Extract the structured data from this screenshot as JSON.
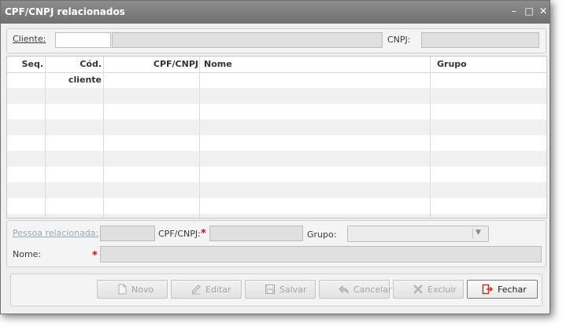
{
  "window": {
    "title": "CPF/CNPJ relacionados",
    "controls": {
      "minimize": "–",
      "maximize": "□",
      "close": "✕"
    }
  },
  "filter": {
    "cliente_label": "Cliente:",
    "cliente_code": "",
    "cliente_name": "",
    "cnpj_label": "CNPJ:",
    "cnpj_value": ""
  },
  "grid": {
    "columns": [
      "Seq.",
      "Cód. cliente",
      "CPF/CNPJ",
      "Nome",
      "Grupo"
    ],
    "rows": []
  },
  "form": {
    "pessoa_label": "Pessoa relacionada:",
    "cpf_label": "CPF/CNPJ:",
    "grupo_label": "Grupo:",
    "nome_label": "Nome:",
    "required_mark": "*"
  },
  "toolbar": {
    "novo": "Novo",
    "editar": "Editar",
    "salvar": "Salvar",
    "cancelar": "Cancelar",
    "excluir": "Excluir",
    "fechar": "Fechar"
  },
  "icons": {
    "novo": "document-icon",
    "editar": "pencil-icon",
    "salvar": "floppy-icon",
    "cancelar": "undo-icon",
    "excluir": "x-icon",
    "fechar": "exit-door-icon"
  },
  "colors": {
    "titlebar": "#7c7c7c",
    "required": "#d01010",
    "disabled_link": "#9aa8b4",
    "exit_icon": "#d0311e"
  }
}
